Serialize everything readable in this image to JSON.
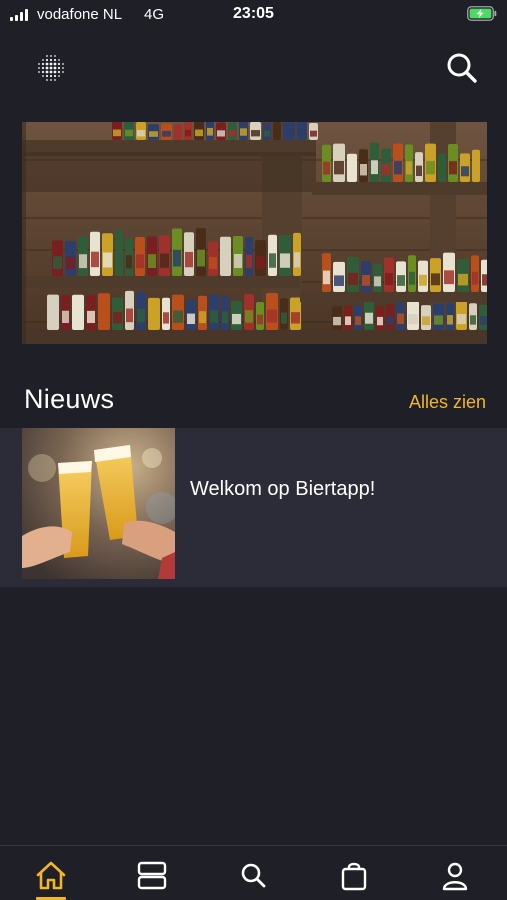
{
  "status_bar": {
    "carrier": "vodafone NL",
    "network": "4G",
    "time": "23:05"
  },
  "news": {
    "section_title": "Nieuws",
    "see_all_label": "Alles zien",
    "items": [
      {
        "headline": "Welkom op Biertapp!"
      }
    ]
  },
  "bottom_nav": {
    "items": [
      "home-icon",
      "catalog-icon",
      "search-icon",
      "shopping-bag-icon",
      "profile-icon"
    ],
    "active": "home-icon"
  },
  "colors": {
    "background": "#1e1f27",
    "card": "#2b2c37",
    "accent": "#f3b628",
    "text": "#ffffff"
  }
}
